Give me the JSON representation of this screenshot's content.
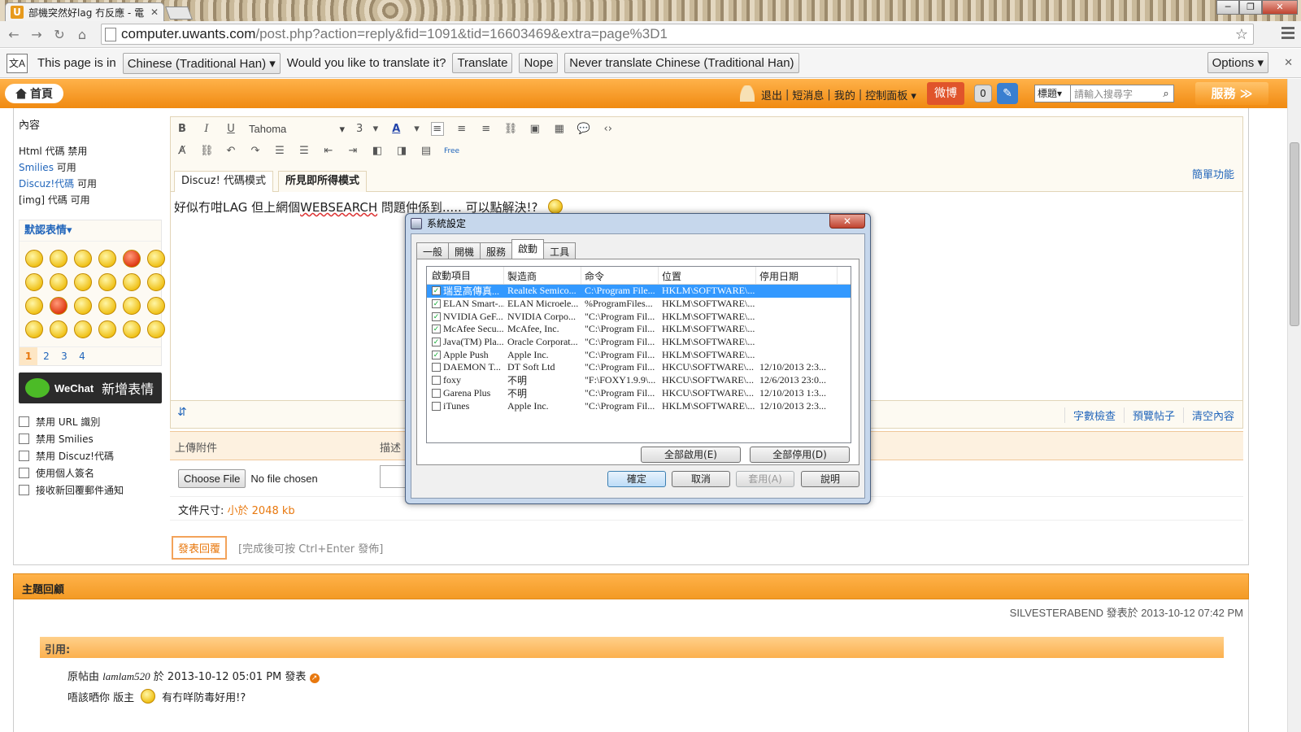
{
  "browser": {
    "tab_title": "部機突然好lag 冇反應 - 電",
    "tab_favicon": "U",
    "url_host": "computer.uwants.com",
    "url_rest": "/post.php?action=reply&fid=1091&tid=16603469&extra=page%3D1",
    "window_buttons": [
      "─",
      "❐",
      "✕"
    ]
  },
  "translate_bar": {
    "page_is_in": "This page is in",
    "language": "Chinese (Traditional Han)",
    "question": "Would you like to translate it?",
    "translate": "Translate",
    "nope": "Nope",
    "never": "Never translate Chinese (Traditional Han)",
    "options": "Options"
  },
  "site_nav": {
    "home": "首頁",
    "logout": "退出",
    "messages": "短消息",
    "mine": "我的",
    "control_panel": "控制面板",
    "weibo": "微博",
    "notification_count": "0",
    "search_select": "標題",
    "search_placeholder": "請輸入搜尋字",
    "services": "服務"
  },
  "left_panel": {
    "content_label": "內容",
    "rules": [
      {
        "name": "Html 代碼",
        "status": "禁用"
      },
      {
        "name": "Smilies",
        "status": "可用"
      },
      {
        "name": "Discuz!代碼",
        "status": "可用"
      },
      {
        "name": "[img] 代碼",
        "status": "可用"
      }
    ],
    "emoticons_title": "默認表情",
    "pages": [
      "1",
      "2",
      "3",
      "4"
    ],
    "wechat_brand": "WeChat",
    "wechat_add": "新增表情",
    "options": [
      "禁用 URL 識別",
      "禁用 Smilies",
      "禁用 Discuz!代碼",
      "使用個人簽名",
      "接收新回覆郵件通知"
    ]
  },
  "editor": {
    "font": "Tahoma",
    "size": "3",
    "tab_discuz": "Discuz! 代碼模式",
    "tab_wysiwyg": "所見即所得模式",
    "simple_mode": "簡單功能",
    "content_before": "好似冇咁LAG  但上網個",
    "content_underlined": "WEBSEARCH",
    "content_after": " 問題仲係到..... 可以點解決!?",
    "word_count": "字數檢查",
    "preview": "預覽帖子",
    "clear": "清空內容"
  },
  "attachments": {
    "upload_label": "上傳附件",
    "desc_label": "描述",
    "choose_file": "Choose File",
    "no_file": "No file chosen",
    "size_label": "文件尺寸:",
    "size_value": "小於 2048 kb"
  },
  "submit": {
    "button": "發表回覆",
    "hint": "[完成後可按 Ctrl+Enter 發佈]"
  },
  "replies": {
    "title": "主題回顧",
    "meta": "SILVESTERABEND 發表於 2013-10-12 07:42 PM",
    "quote_label": "引用:",
    "quote_author_prefix": "原帖由",
    "quote_author": "lamlam520",
    "quote_author_suffix": "於 2013-10-12 05:01 PM 發表",
    "quote_text_1": "唔該晒你 版主",
    "quote_text_2": "有冇咩防毒好用!?"
  },
  "dialog": {
    "title": "系統設定",
    "tabs": [
      "一般",
      "開機",
      "服務",
      "啟動",
      "工具"
    ],
    "active_tab": "啟動",
    "columns": [
      "啟動項目",
      "製造商",
      "命令",
      "位置",
      "停用日期"
    ],
    "rows": [
      {
        "checked": true,
        "item": "瑞昱高傳真...",
        "maker": "Realtek Semico...",
        "command": "C:\\Program File...",
        "location": "HKLM\\SOFTWARE\\...",
        "disabled": "",
        "selected": true
      },
      {
        "checked": true,
        "item": "ELAN Smart-...",
        "maker": "ELAN Microele...",
        "command": "%ProgramFiles...",
        "location": "HKLM\\SOFTWARE\\...",
        "disabled": "",
        "selected": false
      },
      {
        "checked": true,
        "item": "NVIDIA GeF...",
        "maker": "NVIDIA Corpo...",
        "command": "\"C:\\Program Fil...",
        "location": "HKLM\\SOFTWARE\\...",
        "disabled": "",
        "selected": false
      },
      {
        "checked": true,
        "item": "McAfee Secu...",
        "maker": "McAfee, Inc.",
        "command": "\"C:\\Program Fil...",
        "location": "HKLM\\SOFTWARE\\...",
        "disabled": "",
        "selected": false
      },
      {
        "checked": true,
        "item": "Java(TM) Pla...",
        "maker": "Oracle Corporat...",
        "command": "\"C:\\Program Fil...",
        "location": "HKLM\\SOFTWARE\\...",
        "disabled": "",
        "selected": false
      },
      {
        "checked": true,
        "item": "Apple Push",
        "maker": "Apple Inc.",
        "command": "\"C:\\Program Fil...",
        "location": "HKLM\\SOFTWARE\\...",
        "disabled": "",
        "selected": false
      },
      {
        "checked": false,
        "item": "DAEMON T...",
        "maker": "DT Soft Ltd",
        "command": "\"C:\\Program Fil...",
        "location": "HKCU\\SOFTWARE\\...",
        "disabled": "12/10/2013 2:3...",
        "selected": false
      },
      {
        "checked": false,
        "item": "foxy",
        "maker": "不明",
        "command": "\"F:\\FOXY1.9.9\\...",
        "location": "HKCU\\SOFTWARE\\...",
        "disabled": "12/6/2013 23:0...",
        "selected": false
      },
      {
        "checked": false,
        "item": "Garena Plus",
        "maker": "不明",
        "command": "\"C:\\Program Fil...",
        "location": "HKCU\\SOFTWARE\\...",
        "disabled": "12/10/2013 1:3...",
        "selected": false
      },
      {
        "checked": false,
        "item": "iTunes",
        "maker": "Apple Inc.",
        "command": "\"C:\\Program Fil...",
        "location": "HKLM\\SOFTWARE\\...",
        "disabled": "12/10/2013 2:3...",
        "selected": false
      }
    ],
    "enable_all": "全部啟用(E)",
    "disable_all": "全部停用(D)",
    "ok": "確定",
    "cancel": "取消",
    "apply": "套用(A)",
    "help": "說明"
  }
}
